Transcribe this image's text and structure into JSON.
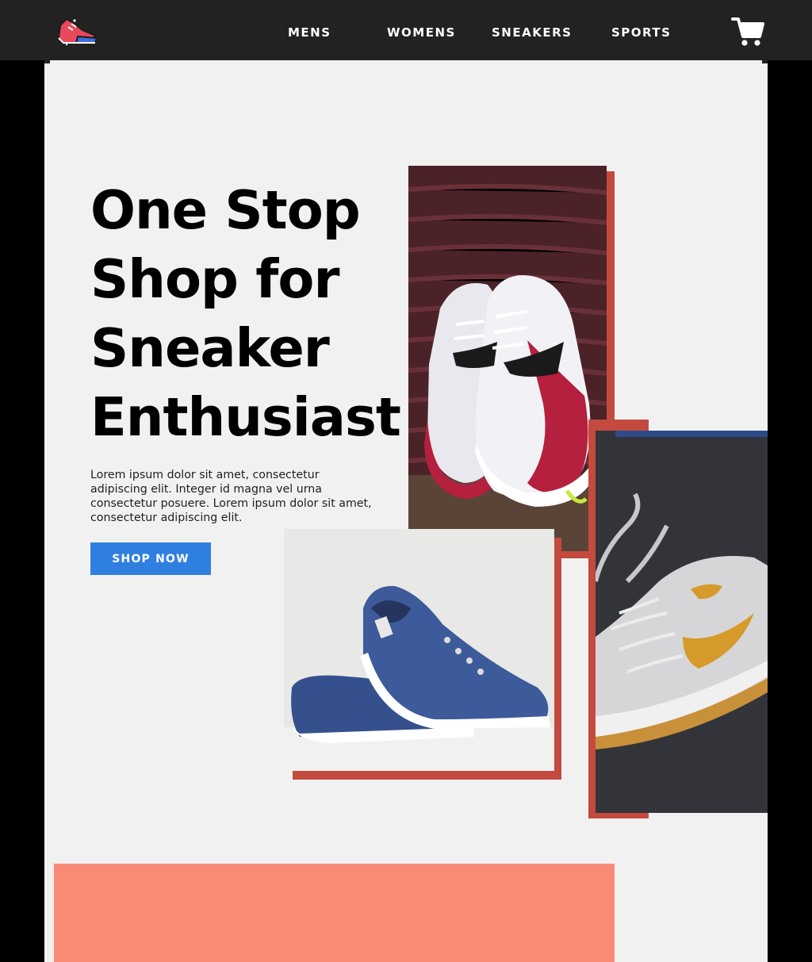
{
  "nav": {
    "logo_icon": "sneaker-logo-icon",
    "links": [
      "MENS",
      "WOMENS",
      "SNEAKERS",
      "SPORTS"
    ],
    "cart_icon": "shopping-cart-icon",
    "background": "#222222"
  },
  "hero": {
    "headline_lines": [
      "One Stop",
      "Shop for",
      "Sneaker",
      "Enthusiast"
    ],
    "body": "Lorem ipsum dolor sit amet, consectetur adipiscing elit. Integer id magna vel urna consectetur posuere. Lorem ipsum dolor sit amet, consectetur adipiscing elit.",
    "cta_label": "SHOP NOW"
  },
  "images": [
    {
      "subject": "white-red-sneakers-photo"
    },
    {
      "subject": "blue-canvas-sneakers-photo"
    },
    {
      "subject": "grey-hightop-sneaker-photo"
    }
  ],
  "colors": {
    "accent": "#2f7fe0",
    "shadow_red": "#c44a3f",
    "coral": "#f98a76",
    "panel": "#f1f1f1"
  }
}
